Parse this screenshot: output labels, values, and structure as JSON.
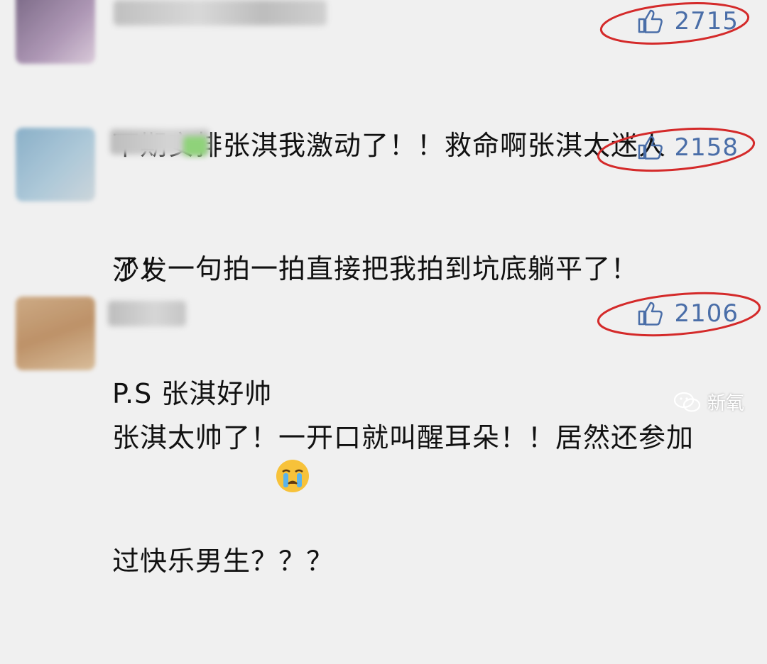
{
  "comments": [
    {
      "likes": "2715",
      "lines": [
        "下期安排张淇我激动了！！救命啊张淇太迷人",
        "了！一句拍一拍直接把我拍到坑底躺平了！"
      ]
    },
    {
      "likes": "2158",
      "lines": [
        "沙发",
        "P.S 张淇好帅"
      ]
    },
    {
      "likes": "2106",
      "lines": [
        "张淇太帅了！一开口就叫醒耳朵！！居然还参加",
        "过快乐男生？？？"
      ]
    }
  ],
  "watermark": {
    "text": "新氧"
  },
  "colors": {
    "background": "#f0f0f0",
    "like_count": "#4a6ea8",
    "annotation_ring": "#d42a2a"
  },
  "icons": {
    "like": "thumbs-up-icon",
    "emoji": "crying-face-icon",
    "watermark": "wechat-logo-icon"
  }
}
